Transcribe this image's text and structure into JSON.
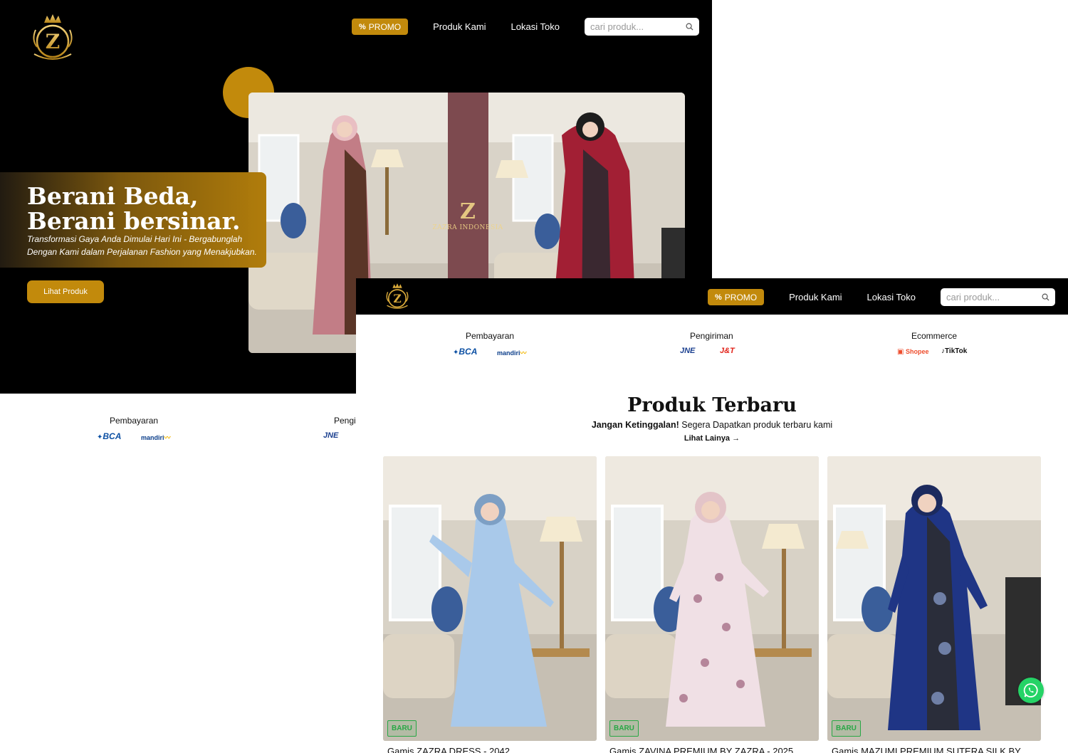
{
  "header": {
    "promo_label": "PROMO",
    "nav": [
      "Produk Kami",
      "Lokasi Toko"
    ],
    "search_placeholder": "cari produk..."
  },
  "hero": {
    "headline_line1": "Berani Beda,",
    "headline_line2": "Berani bersinar.",
    "subline_line1": "Transformasi Gaya Anda Dimulai Hari Ini - Bergabunglah",
    "subline_line2": "Dengan Kami dalam Perjalanan Fashion yang Menakjubkan.",
    "cta_label": "Lihat Produk",
    "watermark": "ZAZRA INDONESIA"
  },
  "partners": [
    {
      "label": "Pembayaran",
      "logos": [
        "BCA",
        "mandiri"
      ]
    },
    {
      "label": "Pengiriman",
      "logos": [
        "JNE",
        "J&T"
      ]
    },
    {
      "label": "Ecommerce",
      "logos": [
        "Shopee",
        "TikTok"
      ]
    }
  ],
  "partial": {
    "label2": "Pengi"
  },
  "latest": {
    "title": "Produk Terbaru",
    "subtitle_bold": "Jangan Ketinggalan!",
    "subtitle_rest": " Segera Dapatkan produk terbaru kami",
    "more_label": "Lihat Lainya",
    "products": [
      {
        "badge": "BARU",
        "title": "Gamis ZAZRA DRESS - 2042",
        "color": "#9fc3e6"
      },
      {
        "badge": "BARU",
        "title": "Gamis ZAVINA PREMIUM BY ZAZRA - 2025",
        "color": "#ecd7dc"
      },
      {
        "badge": "BARU",
        "title": "Gamis MAZUMI PREMIUM SUTERA SILK BY",
        "color": "#1f2f6e"
      }
    ]
  },
  "colors": {
    "accent": "#c28a0c",
    "header_bg": "#000000",
    "badge_green": "#28a745",
    "whatsapp": "#25d366"
  },
  "icons": [
    "crown-logo-icon",
    "percent-icon",
    "search-icon",
    "arrow-right-icon",
    "whatsapp-icon"
  ]
}
